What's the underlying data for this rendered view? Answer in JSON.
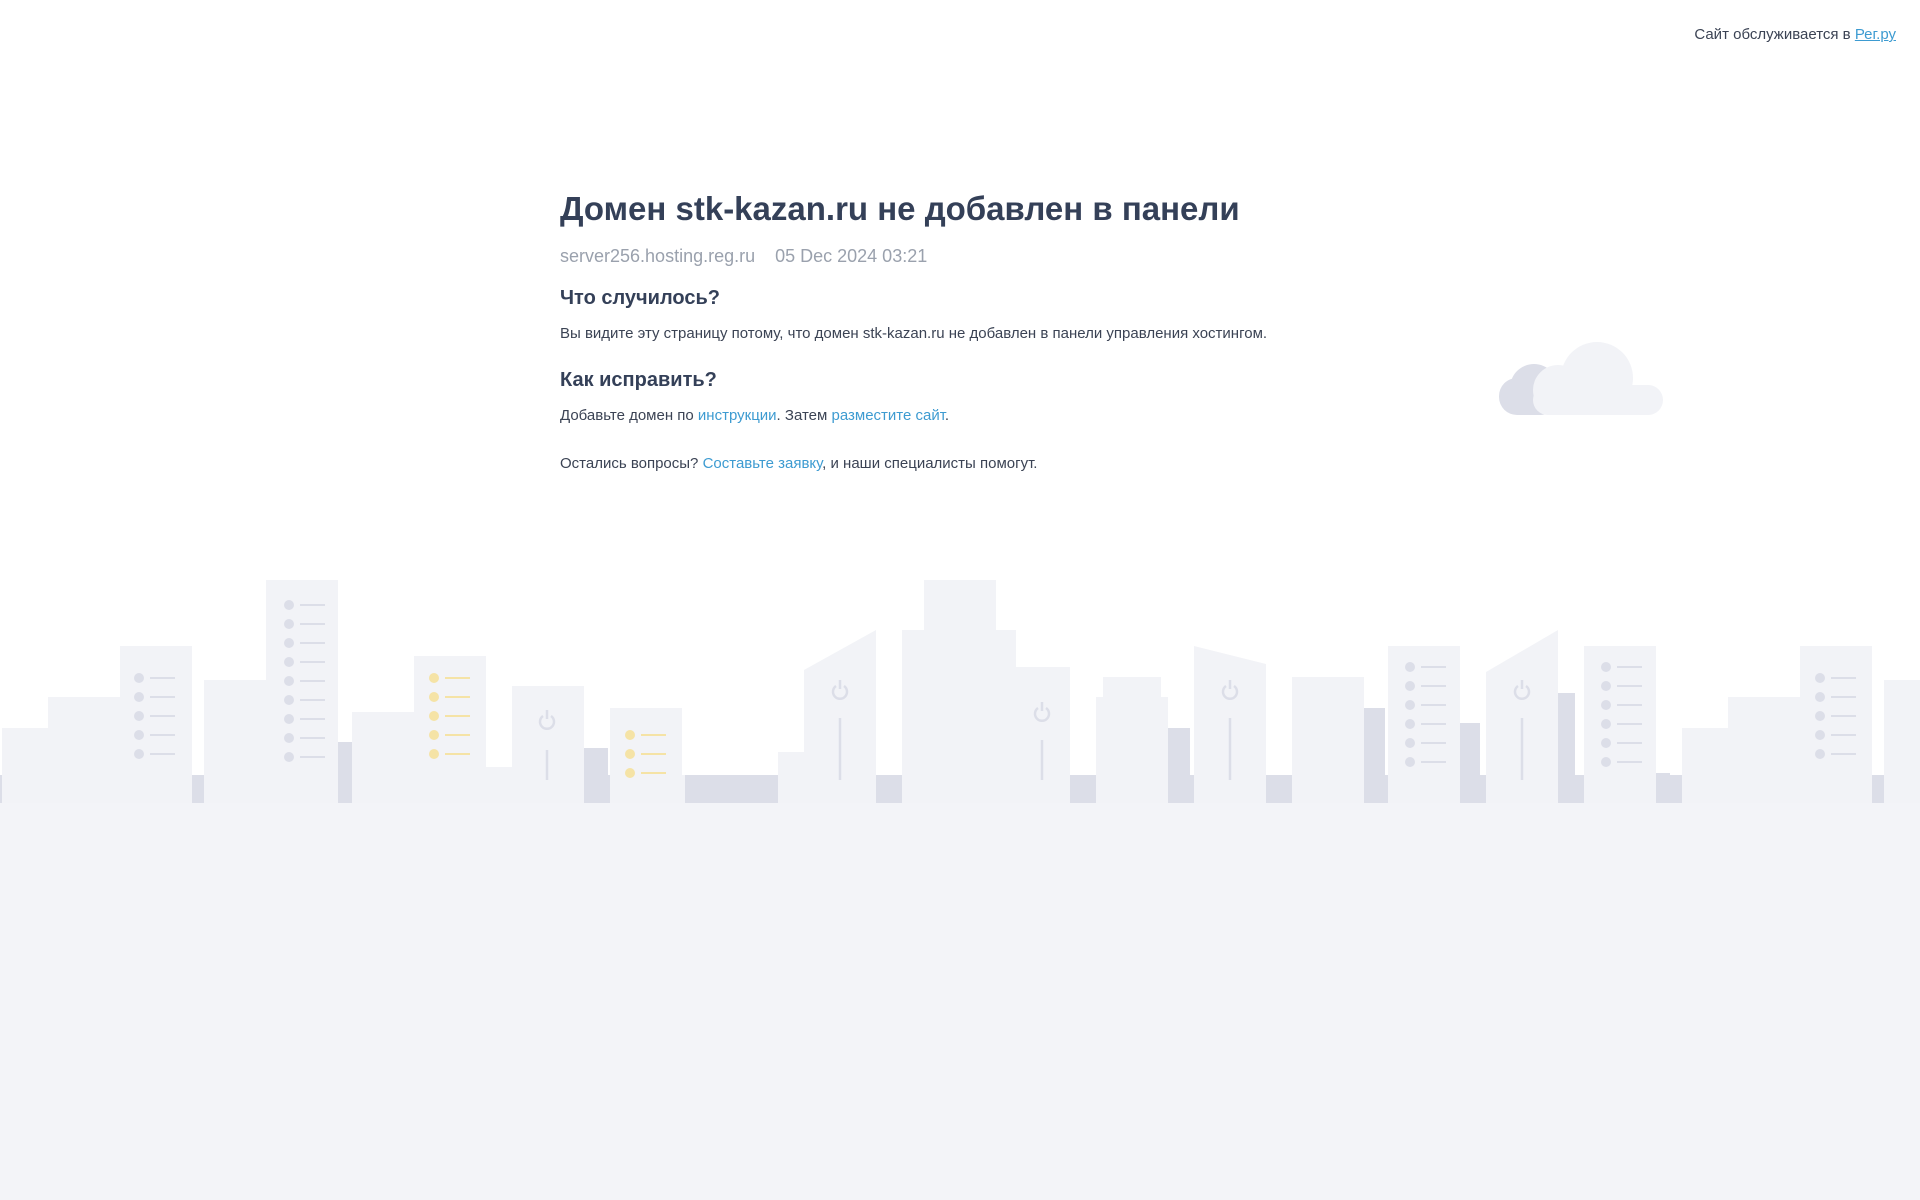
{
  "header": {
    "service_prefix": "Сайт обслуживается в ",
    "service_link": "Рег.ру"
  },
  "main": {
    "title": "Домен stk-kazan.ru не добавлен в панели",
    "server": "server256.hosting.reg.ru",
    "datetime": "05 Dec 2024 03:21",
    "what_happened_heading": "Что случилось?",
    "what_happened_text": "Вы видите эту страницу потому, что домен stk-kazan.ru не добавлен в панели управления хостингом.",
    "how_fix_heading": "Как исправить?",
    "fix_text_1": "Добавьте домен по ",
    "fix_link_1": "инструкции",
    "fix_text_2": ". Затем ",
    "fix_link_2": "разместите сайт",
    "fix_text_3": ".",
    "questions_text_1": "Остались вопросы? ",
    "questions_link": "Составьте заявку",
    "questions_text_2": ", и наши специалисты помогут."
  },
  "colors": {
    "link": "#3d9bd1",
    "heading": "#344058",
    "muted": "#9aa1ad",
    "ground": "#f3f4f8",
    "building_light": "#f2f3f7",
    "building_dark": "#dcdee8",
    "accent_yellow": "#f5e3a6"
  },
  "icons": {
    "cloud": "cloud-icon",
    "power": "power-icon"
  }
}
